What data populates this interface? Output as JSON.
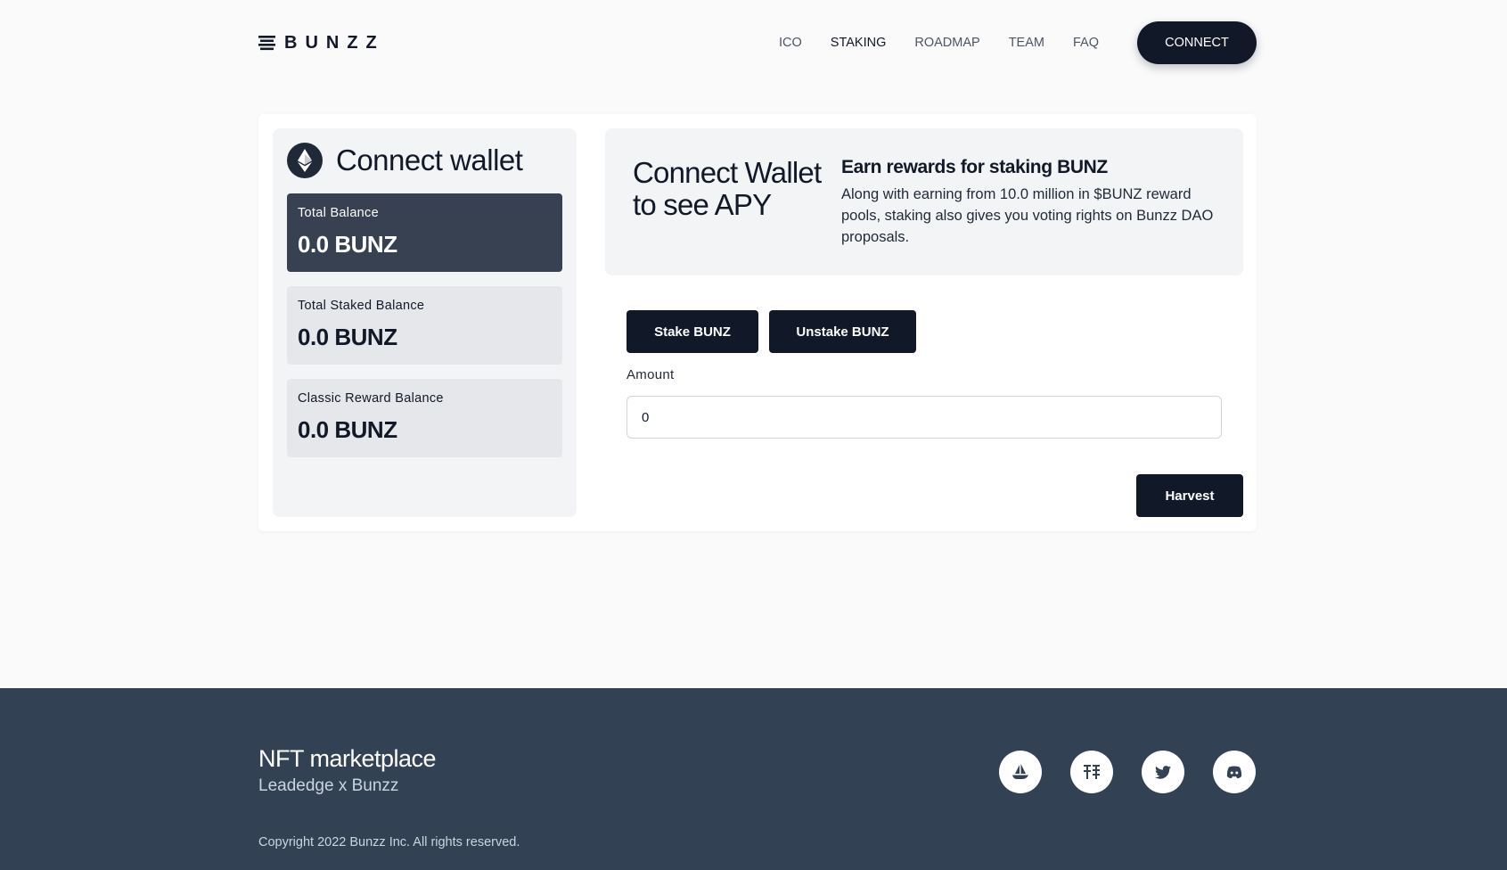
{
  "header": {
    "logo_text": "BUNZZ",
    "nav": [
      {
        "label": "ICO",
        "active": false
      },
      {
        "label": "STAKING",
        "active": true
      },
      {
        "label": "ROADMAP",
        "active": false
      },
      {
        "label": "TEAM",
        "active": false
      },
      {
        "label": "FAQ",
        "active": false
      }
    ],
    "connect_label": "CONNECT"
  },
  "wallet": {
    "title": "Connect wallet",
    "icon": "ethereum-icon",
    "balances": [
      {
        "label": "Total Balance",
        "value": "0.0 BUNZ"
      },
      {
        "label": "Total Staked Balance",
        "value": "0.0 BUNZ"
      },
      {
        "label": "Classic Reward Balance",
        "value": "0.0 BUNZ"
      }
    ]
  },
  "apy": {
    "title": "Connect Wallet to see APY",
    "earn_title": "Earn rewards for staking BUNZ",
    "earn_desc": "Along with earning from 10.0 million in $BUNZ reward pools, staking also gives you voting rights on Bunzz DAO proposals."
  },
  "staking": {
    "stake_label": "Stake BUNZ",
    "unstake_label": "Unstake BUNZ",
    "amount_label": "Amount",
    "amount_value": "0",
    "harvest_label": "Harvest"
  },
  "footer": {
    "title": "NFT marketplace",
    "subtitle": "Leadedge x Bunzz",
    "copyright": "Copyright 2022 Bunzz Inc. All rights reserved.",
    "socials": [
      "opensea-icon",
      "mirror-icon",
      "twitter-icon",
      "discord-icon"
    ]
  },
  "colors": {
    "primary_dark": "#111827",
    "card_dark": "#374151",
    "footer_bg": "#334155"
  }
}
